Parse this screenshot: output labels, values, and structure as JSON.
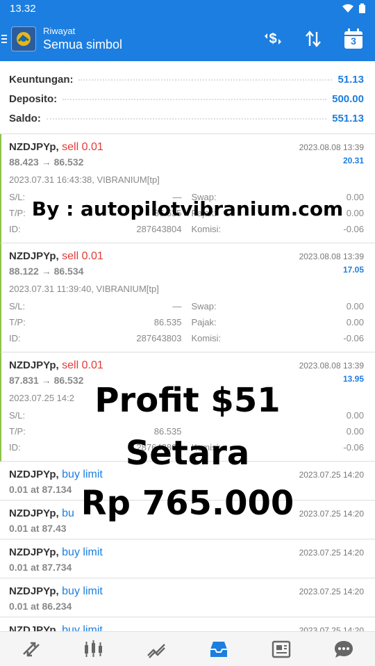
{
  "status": {
    "time": "13.32"
  },
  "header": {
    "subtitle": "Riwayat",
    "title": "Semua simbol",
    "calendar_day": "3"
  },
  "summary": [
    {
      "label": "Keuntungan:",
      "value": "51.13"
    },
    {
      "label": "Deposito:",
      "value": "500.00"
    },
    {
      "label": "Saldo:",
      "value": "551.13"
    }
  ],
  "trades": [
    {
      "symbol": "NZDJPYp,",
      "type": "sell 0.01",
      "close_time": "2023.08.08 13:39",
      "prices": "88.423 → 86.532",
      "profit": "20.31",
      "open_info": "2023.07.31 16:43:38, VIBRANIUM[tp]",
      "sl_label": "S/L:",
      "sl": "—",
      "tp_label": "T/P:",
      "tp": "86.535",
      "id_label": "ID:",
      "id": "287643804",
      "swap_label": "Swap:",
      "swap": "0.00",
      "tax_label": "Pajak:",
      "tax": "0.00",
      "fee_label": "Komisi:",
      "fee": "-0.06"
    },
    {
      "symbol": "NZDJPYp,",
      "type": "sell 0.01",
      "close_time": "2023.08.08 13:39",
      "prices": "88.122 → 86.534",
      "profit": "17.05",
      "open_info": "2023.07.31 11:39:40, VIBRANIUM[tp]",
      "sl_label": "S/L:",
      "sl": "—",
      "tp_label": "T/P:",
      "tp": "86.535",
      "id_label": "ID:",
      "id": "287643803",
      "swap_label": "Swap:",
      "swap": "0.00",
      "tax_label": "Pajak:",
      "tax": "0.00",
      "fee_label": "Komisi:",
      "fee": "-0.06"
    },
    {
      "symbol": "NZDJPYp,",
      "type": "sell 0.01",
      "close_time": "2023.08.08 13:39",
      "prices": "87.831 → 86.532",
      "profit": "13.95",
      "open_info": "2023.07.25 14:2",
      "sl_label": "S/L:",
      "sl": "",
      "tp_label": "T/P:",
      "tp": "86.535",
      "id_label": "ID:",
      "id": "287643802",
      "swap_label": "",
      "swap": "0.00",
      "tax_label": "",
      "tax": "0.00",
      "fee_label": "Komisi:",
      "fee": "-0.06"
    }
  ],
  "orders": [
    {
      "symbol": "NZDJPYp,",
      "type": "buy limit",
      "time": "2023.07.25 14:20",
      "detail": "0.01 at 87.134"
    },
    {
      "symbol": "NZDJPYp,",
      "type": "bu",
      "time": "2023.07.25 14:20",
      "detail": "0.01 at 87.43"
    },
    {
      "symbol": "NZDJPYp,",
      "type": "buy limit",
      "time": "2023.07.25 14:20",
      "detail": "0.01 at 87.734"
    },
    {
      "symbol": "NZDJPYp,",
      "type": "buy limit",
      "time": "2023.07.25 14:20",
      "detail": "0.01 at 86.234"
    },
    {
      "symbol": "NZDJPYp,",
      "type": "buy limit",
      "time": "2023.07.25 14:20",
      "detail": "0.01 at 86.534"
    }
  ],
  "overlay": {
    "line1": "By : autopilotvibranium.com",
    "line2": "Profit $51",
    "line3": "Setara",
    "line4": "Rp 765.000"
  },
  "colors": {
    "accent": "#1c7ee0",
    "sell": "#e53935",
    "closed_bar": "#8bc34a"
  },
  "nav_icons": [
    "quotes-icon",
    "chart-icon",
    "trade-icon",
    "history-icon",
    "news-icon",
    "chat-icon"
  ]
}
